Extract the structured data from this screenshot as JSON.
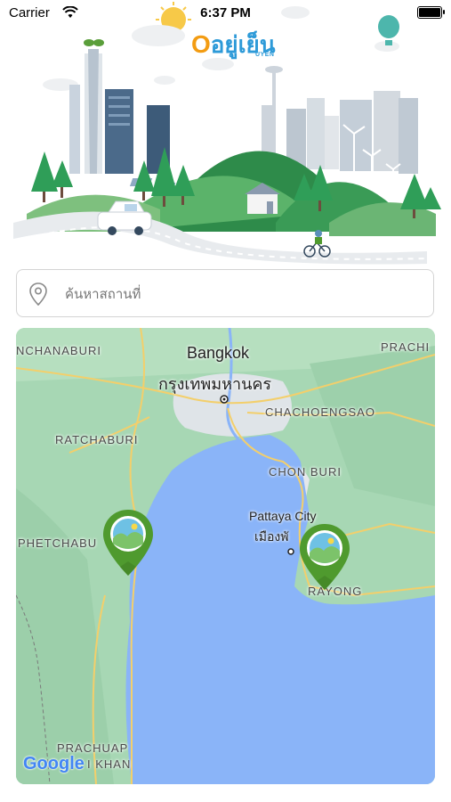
{
  "status_bar": {
    "carrier": "Carrier",
    "time": "6:37 PM"
  },
  "app": {
    "logo_text": "อยู่เย็น",
    "logo_sub": "UYEN"
  },
  "search": {
    "placeholder": "ค้นหาสถานที่",
    "value": ""
  },
  "map": {
    "labels": {
      "kanchanaburi": "NCHANABURI",
      "bangkok_en": "Bangkok",
      "bangkok_th": "กรุงเทพมหานคร",
      "prachin": "PRACHI",
      "chachoengsao": "CHACHOENGSAO",
      "ratchaburi": "RATCHABURI",
      "chon_buri": "CHON BURI",
      "pattaya_en": "Pattaya City",
      "pattaya_th": "เมืองพั",
      "phetchaburi": "PHETCHABU",
      "rayong": "RAYONG",
      "prachuap_1": "PRACHUAP",
      "prachuap_2": "I KHAN"
    },
    "attribution": "Google",
    "markers": [
      "location-marker-west",
      "location-marker-east"
    ]
  },
  "colors": {
    "brand_orange": "#f39c12",
    "brand_blue": "#2d9ad8",
    "marker_green": "#4f9a2e",
    "sea": "#8ab4f8",
    "land": "#a7d7b4"
  }
}
